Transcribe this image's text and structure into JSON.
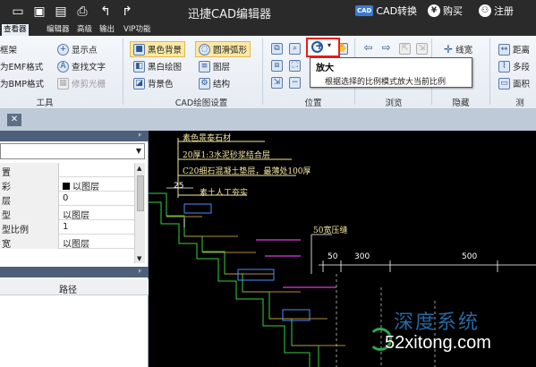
{
  "window": {
    "title": "迅捷CAD编辑器"
  },
  "titlebar": {
    "cad_badge": "CAD",
    "cad_convert": "CAD转换",
    "buy_symbol": "¥",
    "buy": "购买",
    "register_symbol": "⚇",
    "register": "注册"
  },
  "tabs": [
    {
      "label": "查看器",
      "active": true
    },
    {
      "label": "编辑器"
    },
    {
      "label": "高级"
    },
    {
      "label": "输出"
    },
    {
      "label": "VIP功能"
    }
  ],
  "ribbon": {
    "tools": {
      "items": [
        "框架",
        "为EMF格式",
        "为BMP格式",
        "显示点",
        "查找文字",
        "修剪光栅"
      ],
      "label": "工具"
    },
    "cad_settings": {
      "items": [
        "黑色背景",
        "圆滑弧形",
        "黑白绘图",
        "图层",
        "背景色",
        "结构"
      ],
      "label": "CAD绘图设置"
    },
    "position": {
      "label": "位置"
    },
    "browse": {
      "label": "浏览"
    },
    "hide": {
      "items": [
        "线宽"
      ],
      "label": "隐藏"
    },
    "measure": {
      "items": [
        "距离",
        "多段",
        "面积"
      ],
      "label": "测"
    }
  },
  "tooltip": {
    "title": "放大",
    "description": "根据选择的比例模式放大当前比例"
  },
  "properties_panel": {
    "pin": "ᵖ",
    "rows": [
      {
        "key": "置",
        "value": ""
      },
      {
        "key": "彩",
        "value": "以图层",
        "swatch": "#000000"
      },
      {
        "key": "层",
        "value": "0"
      },
      {
        "key": "型",
        "value": "以图层"
      },
      {
        "key": "型比例",
        "value": "1"
      },
      {
        "key": "宽",
        "value": "以图层"
      }
    ]
  },
  "path_panel": {
    "header": "路径"
  },
  "cad_drawing": {
    "texts": [
      "素色景泰石材",
      "20厚1:3水泥砂浆结合层",
      "C20细石混凝土垫层，最薄处100厚",
      "素土人工夯实",
      "50宽压缝",
      "25",
      "50",
      "300",
      "500"
    ]
  },
  "watermark": {
    "cn": "深度系统",
    "en": "52xitong.com"
  }
}
